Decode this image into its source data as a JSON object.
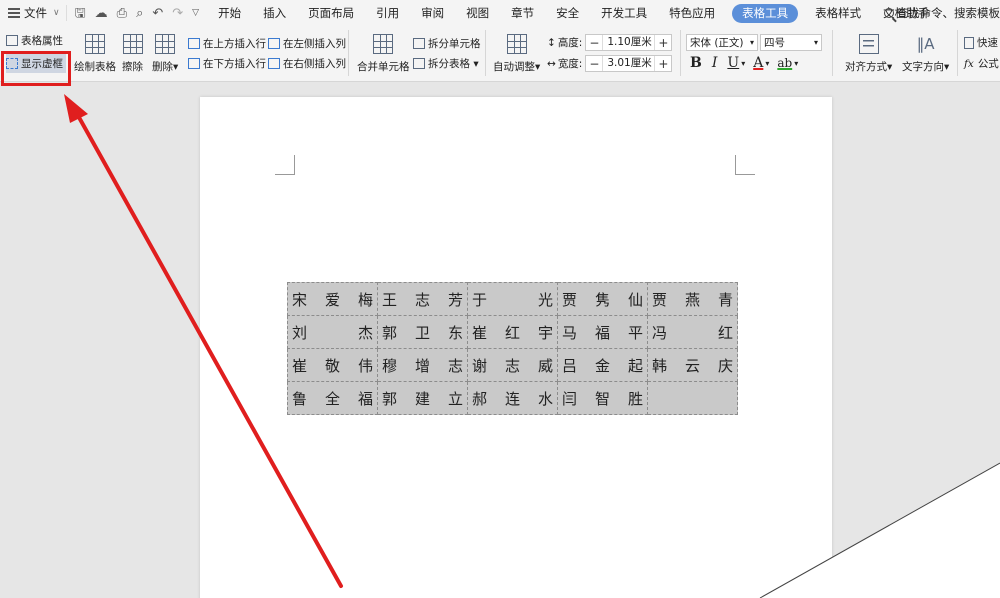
{
  "menubar": {
    "file_label": "文件",
    "tabs": [
      {
        "label": "开始",
        "active": false
      },
      {
        "label": "插入",
        "active": false
      },
      {
        "label": "页面布局",
        "active": false
      },
      {
        "label": "引用",
        "active": false
      },
      {
        "label": "审阅",
        "active": false
      },
      {
        "label": "视图",
        "active": false
      },
      {
        "label": "章节",
        "active": false
      },
      {
        "label": "安全",
        "active": false
      },
      {
        "label": "开发工具",
        "active": false
      },
      {
        "label": "特色应用",
        "active": false
      },
      {
        "label": "表格工具",
        "active": true
      },
      {
        "label": "表格样式",
        "active": false
      },
      {
        "label": "文档助手",
        "active": false
      }
    ],
    "search_text": "查找命令、搜索模板"
  },
  "ribbon": {
    "table_props": "表格属性",
    "show_gridlines": "显示虚框",
    "draw_table": "绘制表格",
    "erase": "擦除",
    "delete": "删除",
    "insert_above": "在上方插入行",
    "insert_below": "在下方插入行",
    "insert_left": "在左侧插入列",
    "insert_right": "在右侧插入列",
    "merge_cells": "合并单元格",
    "split_cells": "拆分单元格",
    "split_table": "拆分表格",
    "auto_fit": "自动调整",
    "height_label": "高度:",
    "height_value": "1.10厘米",
    "width_label": "宽度:",
    "width_value": "3.01厘米",
    "font_name": "宋体 (正文)",
    "font_size": "四号",
    "bold": "B",
    "italic": "I",
    "underline": "U",
    "font_color": "A",
    "highlight": "ab",
    "align": "对齐方式",
    "text_direction": "文字方向",
    "quick_calc": "快速",
    "formula": "公式",
    "font_color_hex": "#e02020",
    "highlight_hex": "#2ea82e"
  },
  "table": {
    "rows": [
      [
        "宋爱梅",
        "王志芳",
        "于光",
        "贾隽仙",
        "贾燕青"
      ],
      [
        "刘杰",
        "郭卫东",
        "崔红宇",
        "马福平",
        "冯红"
      ],
      [
        "崔敬伟",
        "穆增志",
        "谢志威",
        "吕金起",
        "韩云庆"
      ],
      [
        "鲁全福",
        "郭建立",
        "郝连水",
        "闫智胜",
        ""
      ]
    ]
  },
  "annotation": {
    "color": "#e01e1e"
  }
}
